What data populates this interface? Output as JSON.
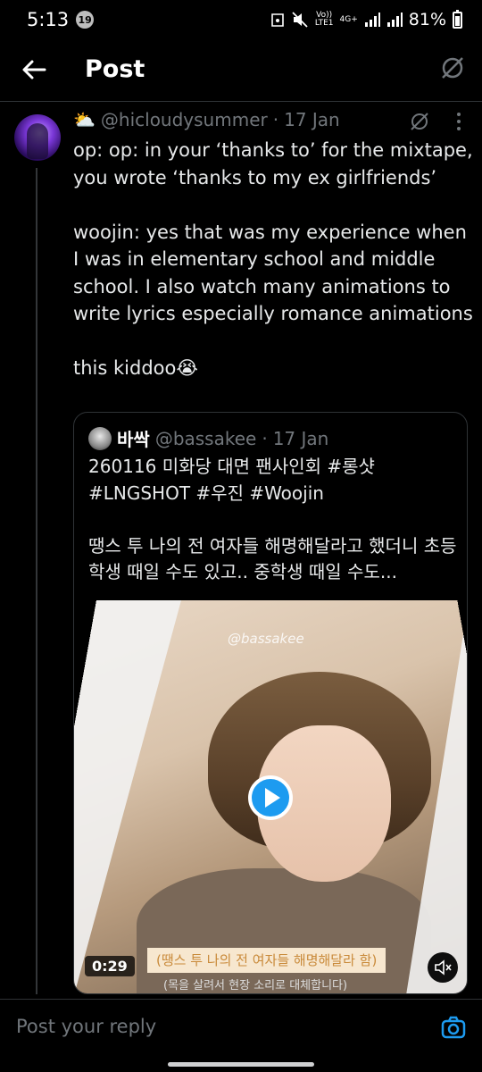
{
  "status_bar": {
    "time": "5:13",
    "notification_count": "19",
    "network_top": "Vo))",
    "network_bottom": "LTE1",
    "network_type": "4G+",
    "battery": "81%"
  },
  "header": {
    "title": "Post",
    "back_icon": "back-arrow-icon",
    "grok_icon": "grok-icon"
  },
  "post": {
    "emoji": "⛅",
    "handle": "@hicloudysummer",
    "separator": "·",
    "date": "17 Jan",
    "text": "op:  op: in your ‘thanks to’ for the mixtape, you wrote ‘thanks to my ex girlfriends’\n\nwoojin: yes that was my experience when I was in elementary school and middle school. I also watch many animations to write lyrics especially romance animations\n\nthis kiddoo😭"
  },
  "quote": {
    "name": "바싹",
    "handle": "@bassakee",
    "separator": "·",
    "date": "17 Jan",
    "text": "260116 미화당 대면 팬사인회 #롱샷 #LNGSHOT #우진 #Woojin\n\n땡스 투 나의 전 여자들 해명해달라고 했더니 초등학생 때일 수도 있고.. 중학생 때일 수도...",
    "media": {
      "watermark": "@bassakee",
      "subtitle": "(땡스 투 나의 전 여자들 해명해달라 함)",
      "subtitle_note": "(목을 살려서 현장 소리로 대체합니다)",
      "duration": "0:29"
    }
  },
  "reply": {
    "placeholder": "Post your reply"
  },
  "colors": {
    "accent": "#1d9bf0",
    "background": "#000000",
    "text_secondary": "#71767b",
    "border": "#2f3336"
  }
}
